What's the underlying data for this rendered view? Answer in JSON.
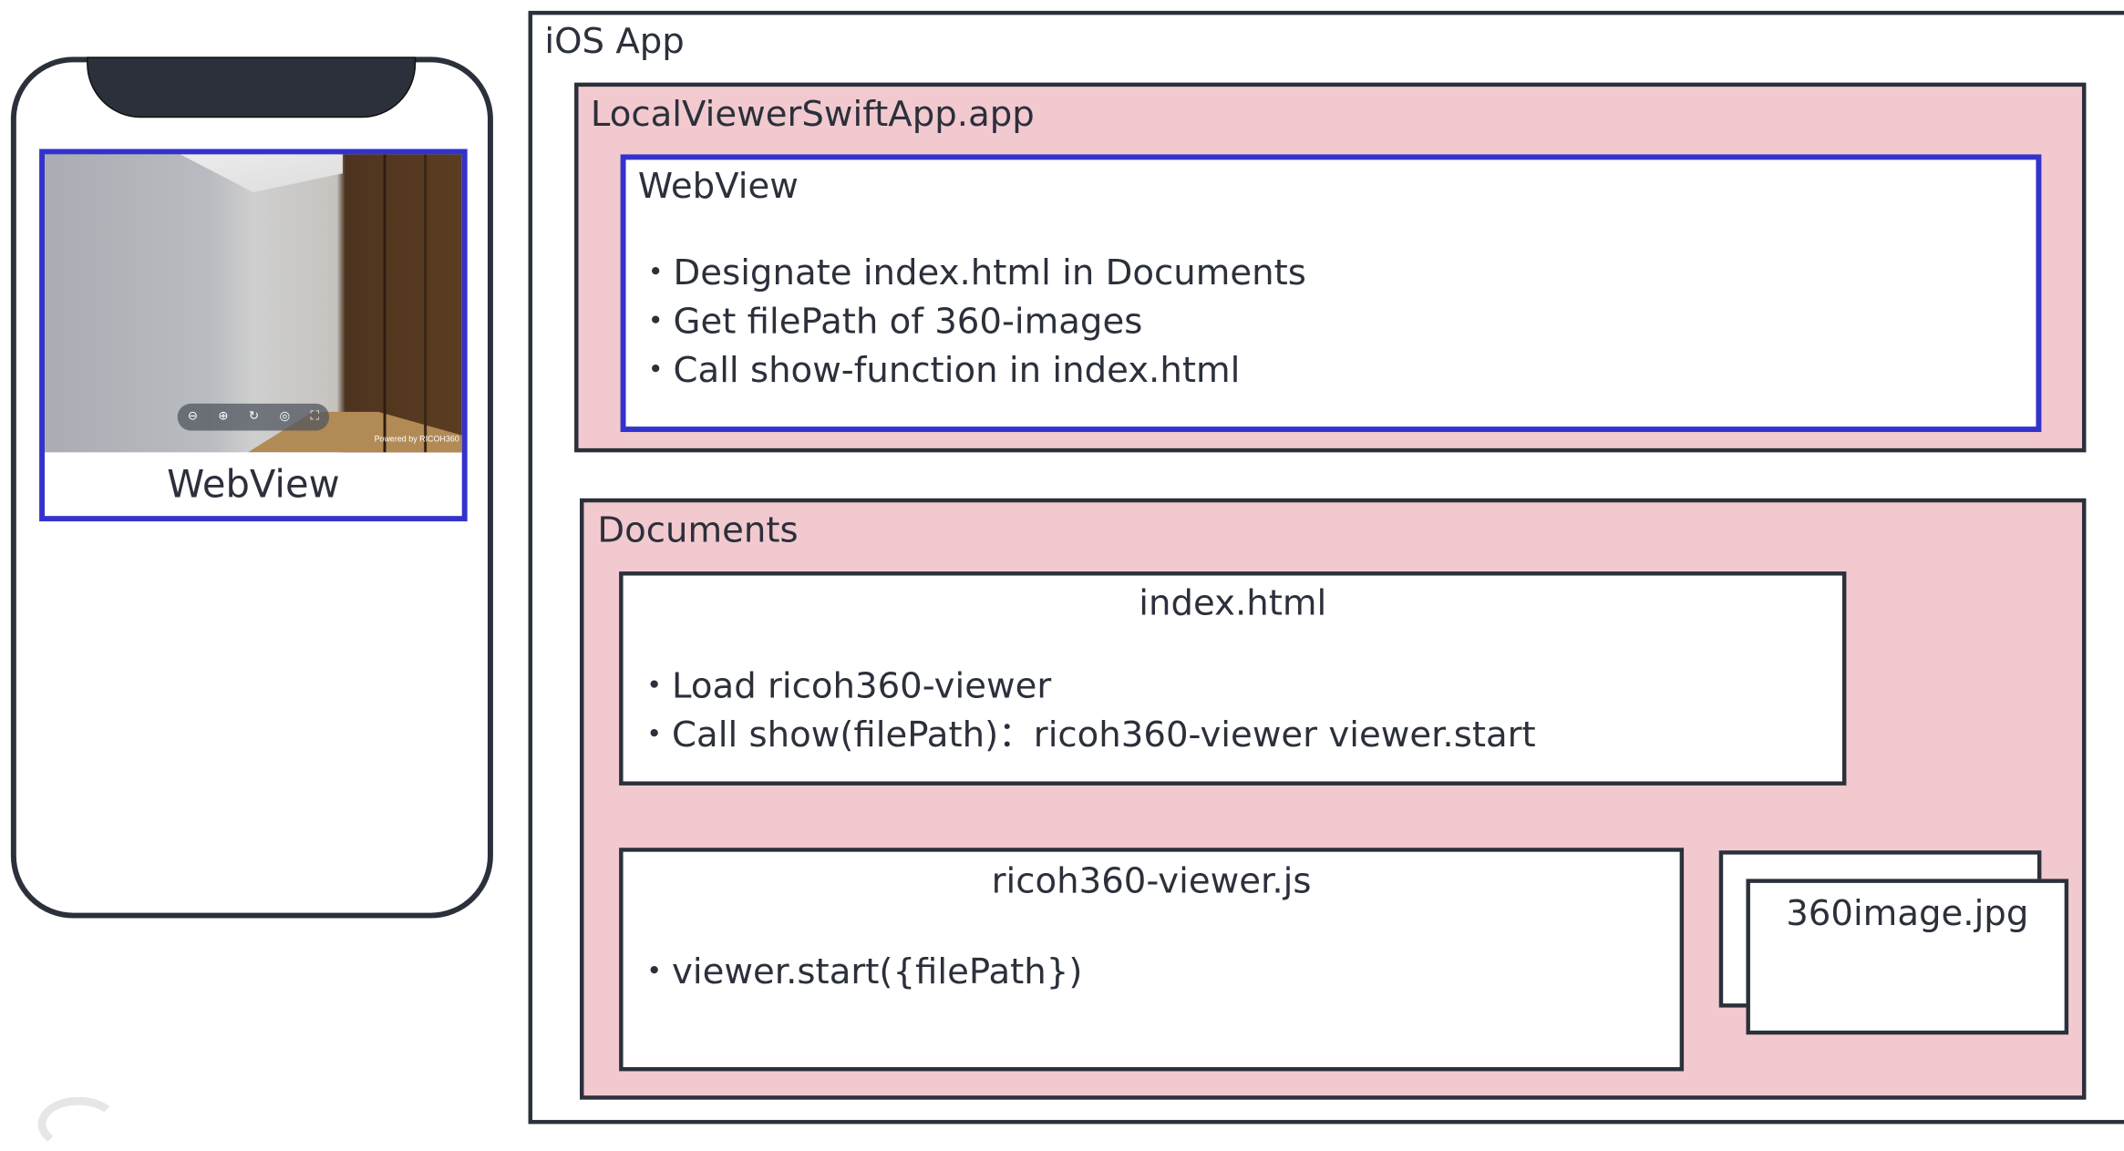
{
  "phone": {
    "webview_label": "WebView",
    "viewer_toolbar": [
      "zoom-out-icon",
      "zoom-in-icon",
      "rotate-icon",
      "compass-icon",
      "fullscreen-icon"
    ],
    "powered_by": "Powered by RICOH360"
  },
  "ios_app": {
    "label": "iOS App",
    "app_bundle": {
      "label": "LocalViewerSwiftApp.app",
      "webview": {
        "title": "WebView",
        "bullets": [
          "・Designate index.html in Documents",
          "・Get filePath of 360-images",
          "・Call show-function in index.html"
        ]
      }
    },
    "documents": {
      "label": "Documents",
      "index_html": {
        "title": "index.html",
        "bullets": [
          "・Load ricoh360-viewer",
          "・Call show(filePath)：ricoh360-viewer viewer.start"
        ]
      },
      "viewer_js": {
        "title": "ricoh360-viewer.js",
        "bullets": [
          "・viewer.start({filePath})"
        ]
      },
      "image_file": "360image.jpg"
    }
  },
  "colors": {
    "ink": "#2b303b",
    "pink": "#f2c9cf",
    "blue": "#3333cc"
  }
}
